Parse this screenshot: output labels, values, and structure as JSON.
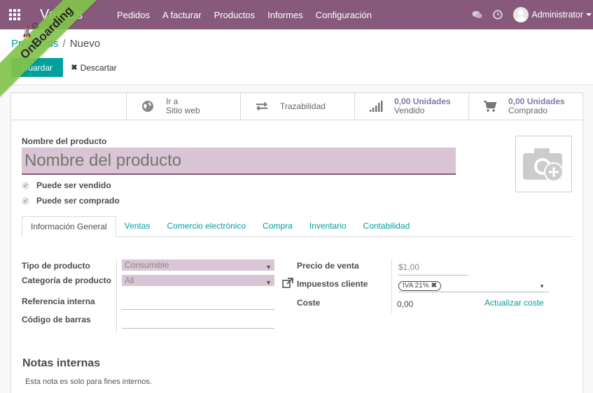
{
  "navbar": {
    "brand": "Ventas",
    "menu": [
      "Pedidos",
      "A facturar",
      "Productos",
      "Informes",
      "Configuración"
    ],
    "user": "Administrator"
  },
  "breadcrumb": {
    "parent": "Productos",
    "separator": "/",
    "current": "Nuevo"
  },
  "actions": {
    "save": "Guardar",
    "discard": "Descartar"
  },
  "ribbon": {
    "label": "OnBoarding"
  },
  "smart_buttons": {
    "website": {
      "line1": "Ir a",
      "line2": "Sitio web"
    },
    "traceability": {
      "label": "Trazabilidad"
    },
    "sold": {
      "value": "0,00 Unidades",
      "label": "Vendido"
    },
    "purchased": {
      "value": "0,00 Unidades",
      "label": "Comprado"
    }
  },
  "product": {
    "name_label": "Nombre del producto",
    "name_placeholder": "Nombre del producto",
    "can_be_sold": "Puede ser vendido",
    "can_be_purchased": "Puede ser comprado"
  },
  "tabs": [
    "Información General",
    "Ventas",
    "Comercio electrónico",
    "Compra",
    "Inventario",
    "Contabilidad"
  ],
  "general": {
    "product_type_label": "Tipo de producto",
    "product_type_value": "Consumible",
    "category_label": "Categoría de producto",
    "category_value": "All",
    "internal_ref_label": "Referencia interna",
    "barcode_label": "Código de barras",
    "sale_price_label": "Precio de venta",
    "sale_price_value": "$1,00",
    "customer_taxes_label": "Impuestos cliente",
    "tax_tag": "IVA 21%",
    "cost_label": "Coste",
    "cost_value": "0,00",
    "update_cost": "Actualizar coste"
  },
  "notes": {
    "title": "Notas internas",
    "placeholder": "Esta nota es solo para fines internos."
  },
  "colors": {
    "brand": "#875a7b",
    "accent": "#00a09d",
    "link": "#7c7bad",
    "ribbon": "#83c34b"
  }
}
